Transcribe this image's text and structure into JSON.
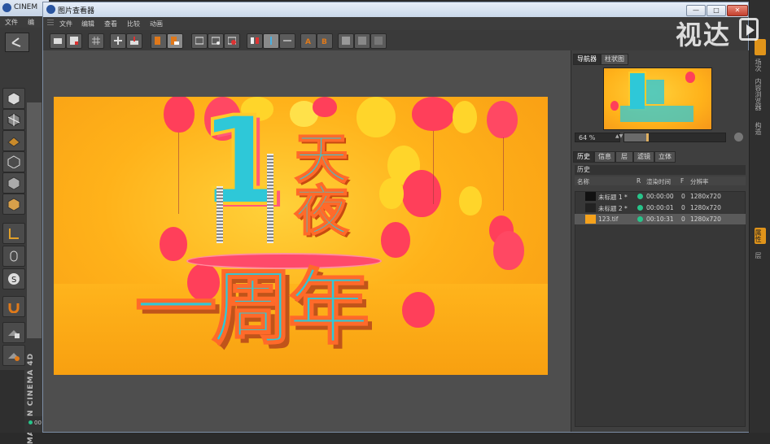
{
  "c4d": {
    "title": "CINEM",
    "menu": [
      "文件",
      "编"
    ],
    "brand_line1": "MAXON",
    "brand_line2": "CINEMA 4D",
    "status_value": "00"
  },
  "viewer": {
    "title": "图片查看器",
    "menu": [
      "文件",
      "编辑",
      "查看",
      "比较",
      "动画"
    ],
    "window_buttons": [
      "—",
      "□",
      "✕"
    ],
    "nav_tabs": [
      "导航器",
      "柱状图"
    ],
    "zoom": "64 %",
    "zoom_fraction": 0.22,
    "lower_tabs": [
      "历史",
      "信息",
      "层",
      "滤镜",
      "立体"
    ],
    "history_header": "历史",
    "history_columns": [
      "名称",
      "R",
      "渲染时间",
      "F",
      "分辨率"
    ],
    "history_rows": [
      {
        "name": "未标题 1 *",
        "time": "00:00:00",
        "frame": "0",
        "res": "1280x720",
        "selected": false
      },
      {
        "name": "未标题 2 *",
        "time": "00:00:01",
        "frame": "0",
        "res": "1280x720",
        "selected": false
      },
      {
        "name": "123.tif",
        "time": "00:10:31",
        "frame": "0",
        "res": "1280x720",
        "selected": true
      }
    ]
  },
  "render": {
    "big_digit": "1",
    "line_top_1": "天",
    "line_top_2": "夜",
    "line_bottom": "一周年"
  },
  "far_right": [
    "场次",
    "内容浏览器",
    "构造",
    "属性",
    "层"
  ],
  "watermark": "视达",
  "colors": {
    "balloon": "#ff3f5a",
    "gold": "#ffd52a",
    "teal": "#2ec8d8",
    "accent_orange": "#e0941a",
    "status_green": "#27c48a"
  }
}
